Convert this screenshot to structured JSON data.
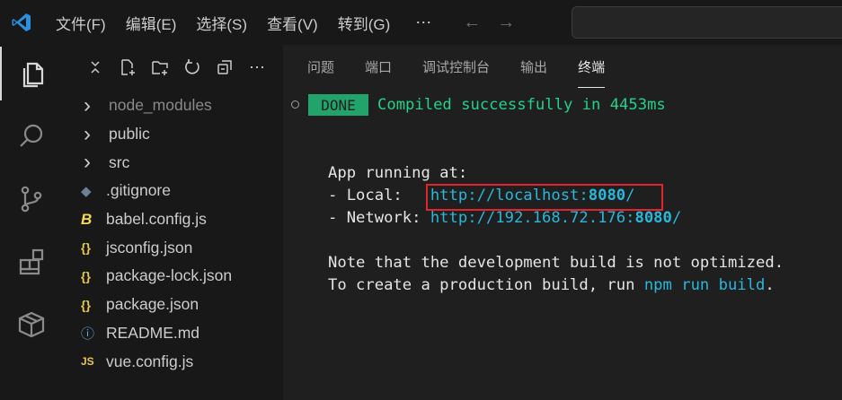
{
  "titlebar": {
    "menu": [
      "文件(F)",
      "编辑(E)",
      "选择(S)",
      "查看(V)",
      "转到(G)"
    ],
    "more": "⋯",
    "back": "←",
    "forward": "→"
  },
  "explorer": {
    "items": [
      {
        "label": "node_modules",
        "icon": "chevron-right-icon",
        "glyph": "›",
        "dim": true
      },
      {
        "label": "public",
        "icon": "chevron-right-icon",
        "glyph": "›"
      },
      {
        "label": "src",
        "icon": "chevron-right-icon",
        "glyph": "›"
      },
      {
        "label": ".gitignore",
        "icon": "git-diamond-icon",
        "glyph": "◆"
      },
      {
        "label": "babel.config.js",
        "icon": "babel-icon",
        "glyph": "B"
      },
      {
        "label": "jsconfig.json",
        "icon": "json-braces-icon",
        "glyph": "{}"
      },
      {
        "label": "package-lock.json",
        "icon": "json-braces-icon",
        "glyph": "{}"
      },
      {
        "label": "package.json",
        "icon": "json-braces-icon",
        "glyph": "{}"
      },
      {
        "label": "README.md",
        "icon": "info-icon",
        "glyph": "ⓘ"
      },
      {
        "label": "vue.config.js",
        "icon": "js-icon",
        "glyph": "JS"
      }
    ]
  },
  "panel": {
    "tabs": [
      "问题",
      "端口",
      "调试控制台",
      "输出",
      "终端"
    ],
    "active_tab": "终端"
  },
  "terminal": {
    "done_badge": "DONE",
    "compiled": "Compiled successfully in 4453ms",
    "app_running": "App running at:",
    "local_label": "- Local:   ",
    "local_url": "http://localhost:",
    "local_port": "8080",
    "local_slash": "/",
    "network_label": "- Network: ",
    "network_url": "http://192.168.72.176:",
    "network_port": "8080",
    "network_slash": "/",
    "note": "Note that the development build is not optimized.",
    "prod_pre": "To create a production build, run ",
    "prod_cmd": "npm run build",
    "prod_post": "."
  },
  "colors": {
    "accent": "#0078d4",
    "done_bg": "#23a36c",
    "success_text": "#23d18b",
    "link": "#29b8db",
    "highlight_box": "#e1252f"
  }
}
